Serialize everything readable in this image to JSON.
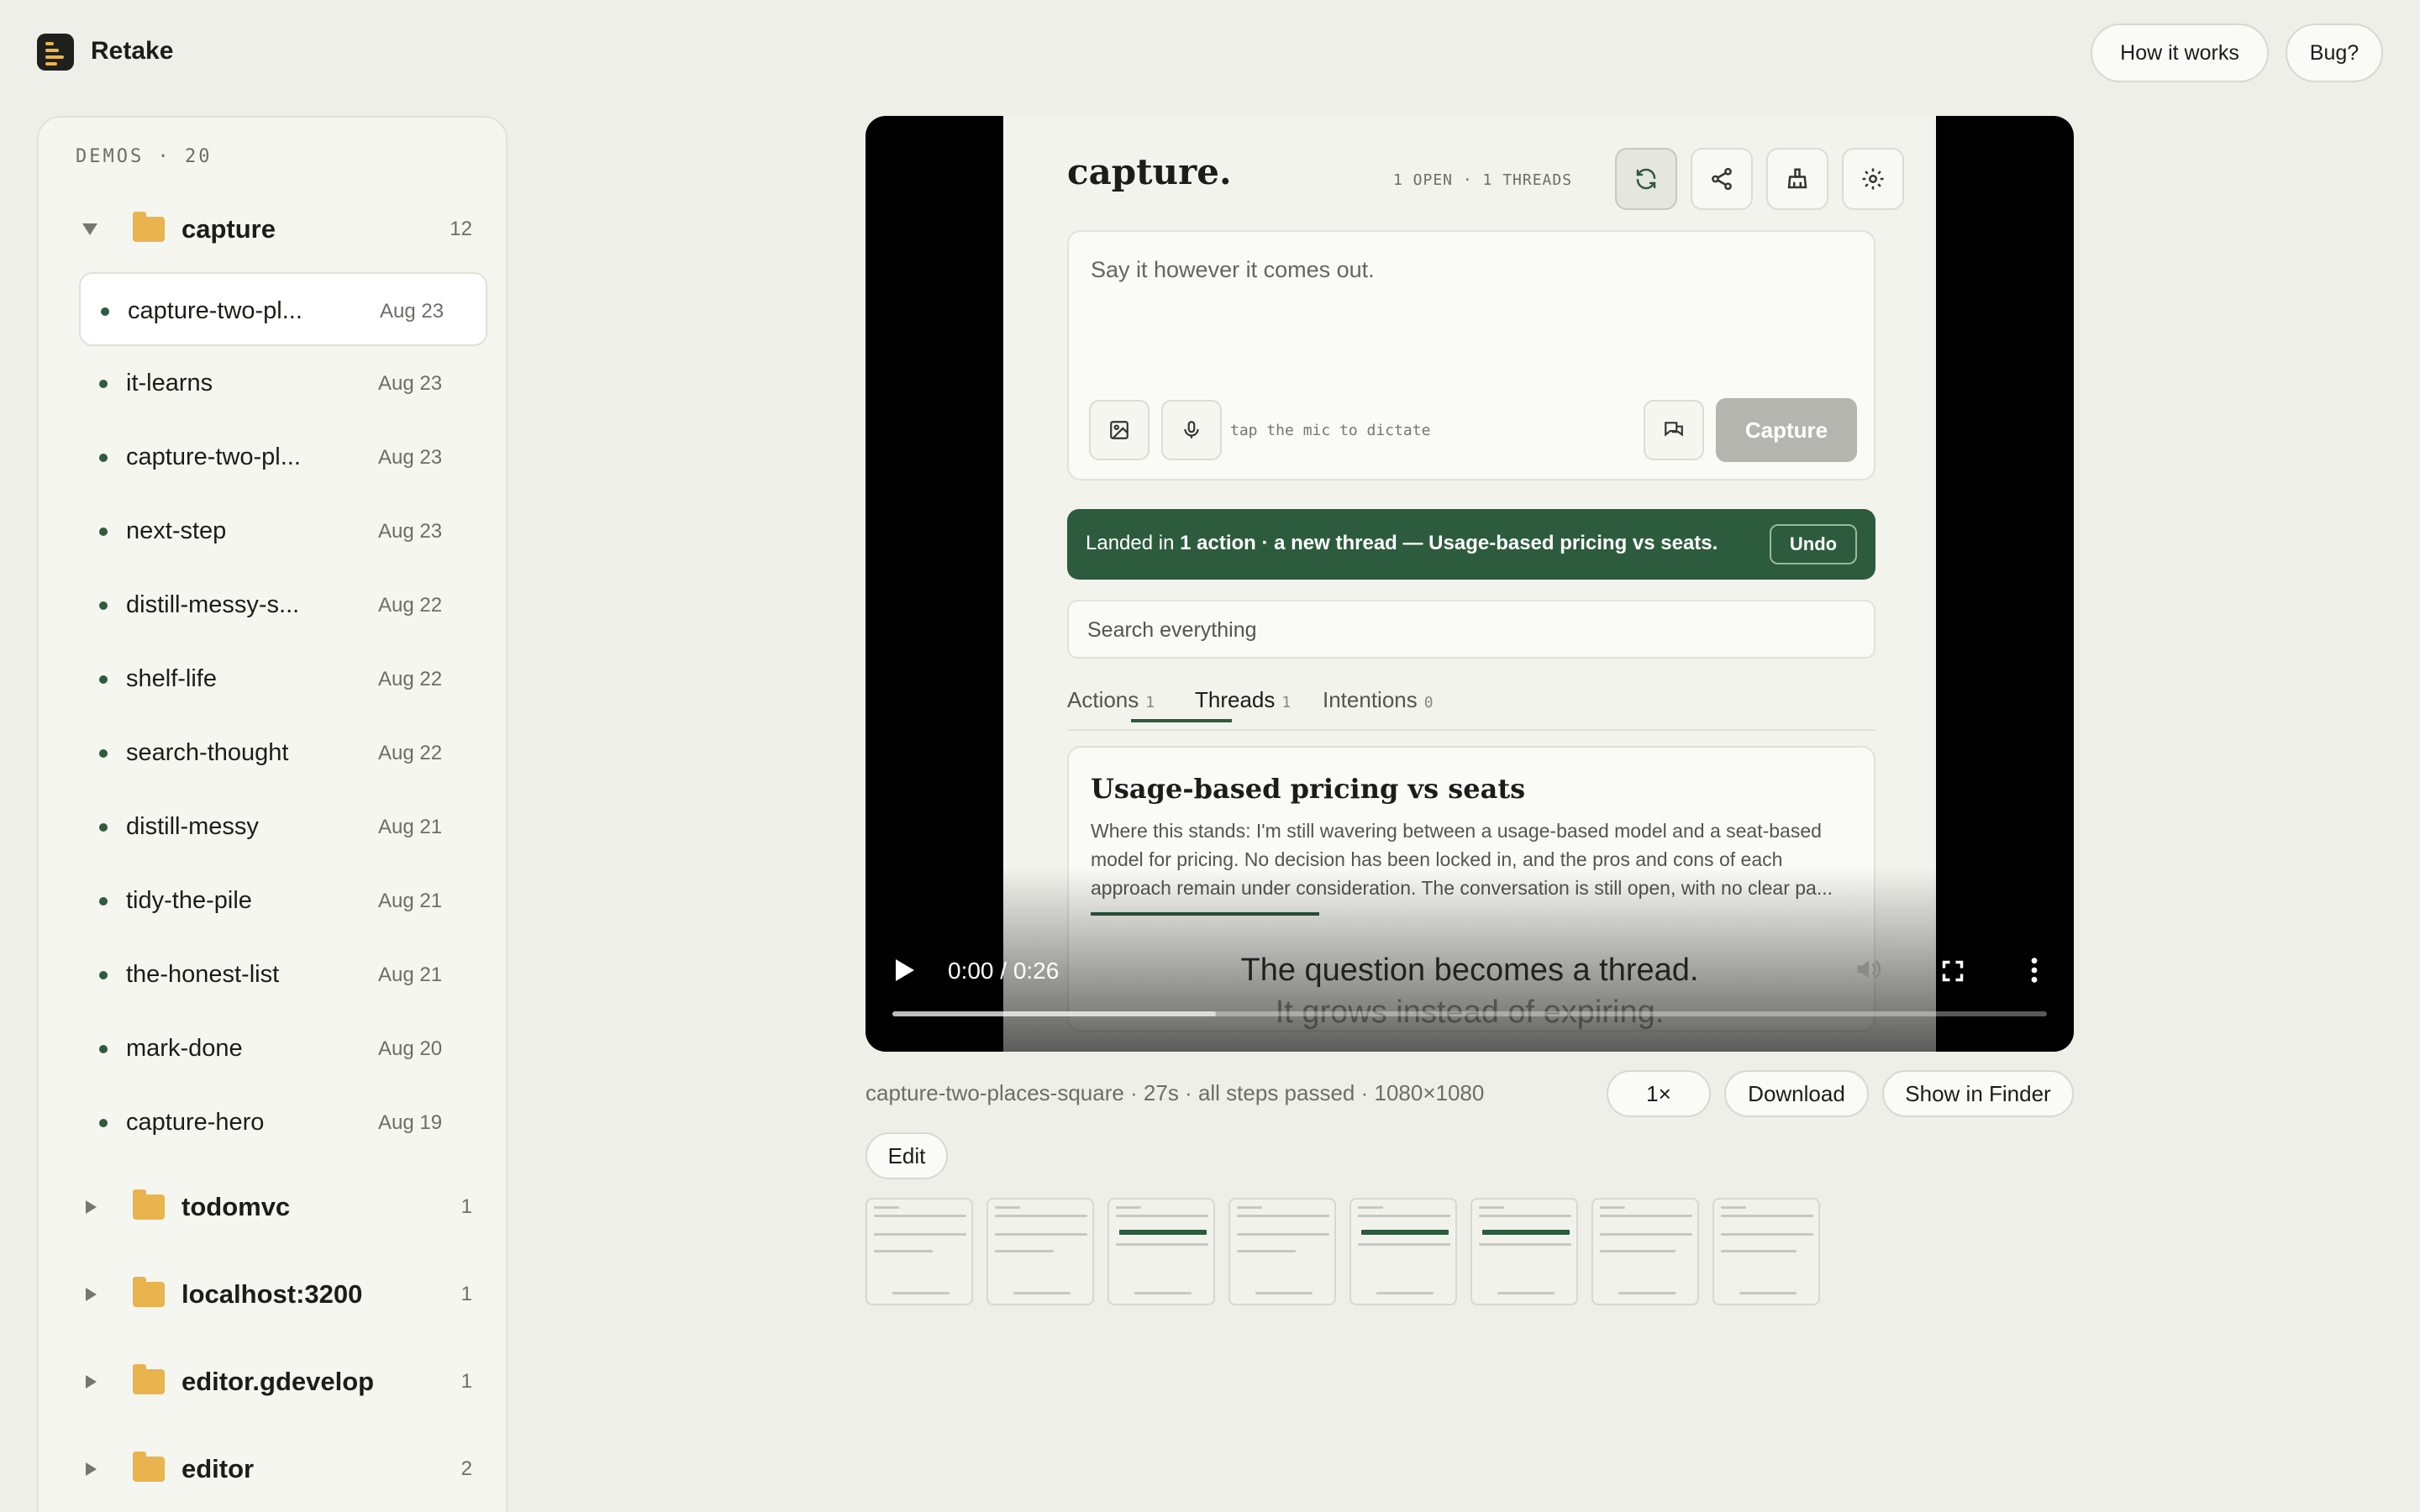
{
  "app": {
    "name": "Retake"
  },
  "header": {
    "how_it_works": "How it works",
    "bug": "Bug?"
  },
  "sidebar": {
    "header": "DEMOS · 20",
    "folders": [
      {
        "name": "capture",
        "count": "12",
        "expanded": true,
        "items": [
          {
            "name": "capture-two-pl...",
            "date": "Aug 23",
            "selected": true
          },
          {
            "name": "it-learns",
            "date": "Aug 23"
          },
          {
            "name": "capture-two-pl...",
            "date": "Aug 23"
          },
          {
            "name": "next-step",
            "date": "Aug 23"
          },
          {
            "name": "distill-messy-s...",
            "date": "Aug 22"
          },
          {
            "name": "shelf-life",
            "date": "Aug 22"
          },
          {
            "name": "search-thought",
            "date": "Aug 22"
          },
          {
            "name": "distill-messy",
            "date": "Aug 21"
          },
          {
            "name": "tidy-the-pile",
            "date": "Aug 21"
          },
          {
            "name": "the-honest-list",
            "date": "Aug 21"
          },
          {
            "name": "mark-done",
            "date": "Aug 20"
          },
          {
            "name": "capture-hero",
            "date": "Aug 19"
          }
        ]
      },
      {
        "name": "todomvc",
        "count": "1",
        "expanded": false
      },
      {
        "name": "localhost:3200",
        "count": "1",
        "expanded": false
      },
      {
        "name": "editor.gdevelop",
        "count": "1",
        "expanded": false
      },
      {
        "name": "editor",
        "count": "2",
        "expanded": false
      }
    ]
  },
  "video": {
    "frame": {
      "logo": "capture.",
      "stats": "1 OPEN · 1 THREADS",
      "input_placeholder": "Say it however it comes out.",
      "mic_hint": "tap the mic to dictate",
      "capture_button": "Capture",
      "banner": {
        "prefix": "Landed in ",
        "bold": "1 action · a new thread — Usage-based pricing vs seats.",
        "undo": "Undo"
      },
      "search_placeholder": "Search everything",
      "tabs": [
        {
          "label": "Actions",
          "count": "1"
        },
        {
          "label": "Threads",
          "count": "1",
          "active": true
        },
        {
          "label": "Intentions",
          "count": "0"
        }
      ],
      "thread": {
        "title": "Usage-based pricing vs seats",
        "body": "Where this stands: I'm still wavering between a usage-based model and a seat-based model for pricing. No decision has been locked in, and the pros and cons of each approach remain under consideration. The conversation is still open, with no clear pa..."
      }
    },
    "caption_line1": "The question becomes a thread.",
    "caption_line2": "It grows instead of expiring.",
    "time": "0:00 / 0:26",
    "progress": 0.28
  },
  "meta": {
    "text": "capture-two-places-square · 27s · all steps passed · 1080×1080",
    "speed": "1×",
    "download": "Download",
    "show_in_finder": "Show in Finder",
    "edit": "Edit"
  },
  "thumbnails_count": 8,
  "colors": {
    "accent_green": "#2c5b3d",
    "folder_yellow": "#e9b44e",
    "background": "#efefea"
  }
}
